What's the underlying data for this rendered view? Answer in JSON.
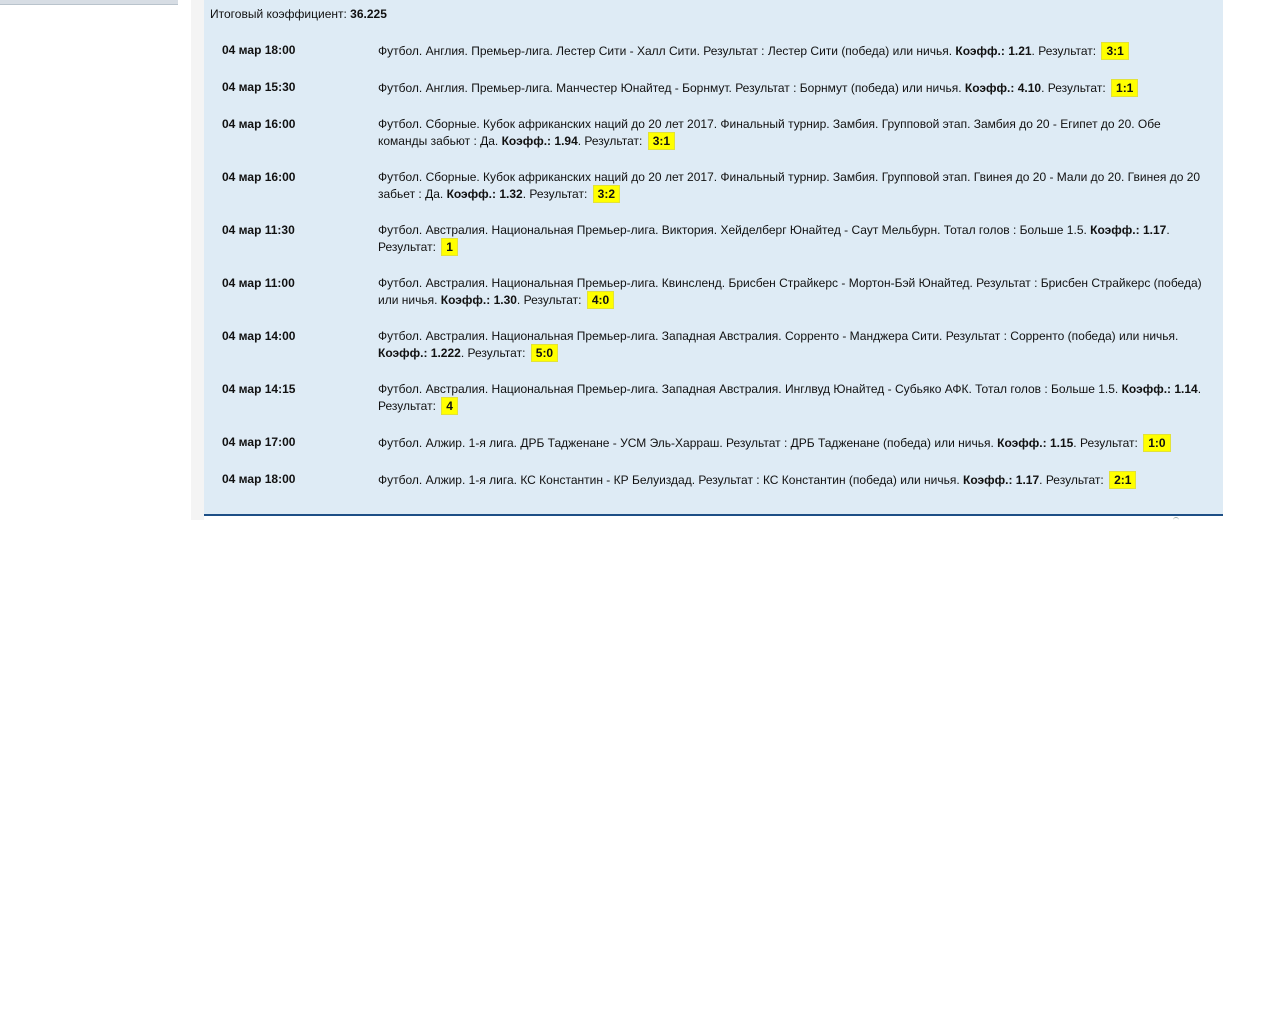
{
  "summary": {
    "total_label": "Итоговый коэффициент:",
    "total_value": "36.225"
  },
  "bets": [
    {
      "time": "04 мар 18:00",
      "text": "Футбол. Англия. Премьер-лига. Лестер Сити - Халл Сити. Результат : Лестер Сити (победа) или ничья.",
      "odds_label": "Коэфф.:",
      "odds": "1.21",
      "result_label": "Результат:",
      "result": "3:1"
    },
    {
      "time": "04 мар 15:30",
      "text": "Футбол. Англия. Премьер-лига. Манчестер Юнайтед - Борнмут. Результат : Борнмут (победа) или ничья.",
      "odds_label": "Коэфф.:",
      "odds": "4.10",
      "result_label": "Результат:",
      "result": "1:1"
    },
    {
      "time": "04 мар 16:00",
      "text": "Футбол. Сборные. Кубок африканских наций до 20 лет 2017. Финальный турнир. Замбия. Групповой этап. Замбия до 20 - Египет до 20. Обе команды забьют : Да.",
      "odds_label": "Коэфф.:",
      "odds": "1.94",
      "result_label": "Результат:",
      "result": "3:1"
    },
    {
      "time": "04 мар 16:00",
      "text": "Футбол. Сборные. Кубок африканских наций до 20 лет 2017. Финальный турнир. Замбия. Групповой этап. Гвинея до 20 - Мали до 20. Гвинея до 20 забьет : Да.",
      "odds_label": "Коэфф.:",
      "odds": "1.32",
      "result_label": "Результат:",
      "result": "3:2"
    },
    {
      "time": "04 мар 11:30",
      "text": "Футбол. Австралия. Национальная Премьер-лига. Виктория. Хейделберг Юнайтед - Саут Мельбурн. Тотал голов : Больше 1.5.",
      "odds_label": "Коэфф.:",
      "odds": "1.17",
      "result_label": "Результат:",
      "result": "1"
    },
    {
      "time": "04 мар 11:00",
      "text": "Футбол. Австралия. Национальная Премьер-лига. Квинсленд. Брисбен Страйкерс - Мортон-Бэй Юнайтед. Результат : Брисбен Страйкерс (победа) или ничья.",
      "odds_label": "Коэфф.:",
      "odds": "1.30",
      "result_label": "Результат:",
      "result": "4:0"
    },
    {
      "time": "04 мар 14:00",
      "text": "Футбол. Австралия. Национальная Премьер-лига. Западная Австралия. Сорренто - Манджера Сити. Результат : Сорренто (победа) или ничья.",
      "odds_label": "Коэфф.:",
      "odds": "1.222",
      "result_label": "Результат:",
      "result": "5:0"
    },
    {
      "time": "04 мар 14:15",
      "text": "Футбол. Австралия. Национальная Премьер-лига. Западная Австралия. Инглвуд Юнайтед - Субьяко АФК. Тотал голов : Больше 1.5.",
      "odds_label": "Коэфф.:",
      "odds": "1.14",
      "result_label": "Результат:",
      "result": "4"
    },
    {
      "time": "04 мар 17:00",
      "text": "Футбол. Алжир. 1-я лига. ДРБ Тадженане - УСМ Эль-Харраш. Результат : ДРБ Тадженане (победа) или ничья.",
      "odds_label": "Коэфф.:",
      "odds": "1.15",
      "result_label": "Результат:",
      "result": "1:0"
    },
    {
      "time": "04 мар 18:00",
      "text": "Футбол. Алжир. 1-я лига. КС Константин - КР Белуиздад. Результат : КС Константин (победа) или ничья.",
      "odds_label": "Коэфф.:",
      "odds": "1.17",
      "result_label": "Результат:",
      "result": "2:1"
    }
  ],
  "colors": {
    "panel_bg": "#deebf5",
    "panel_border": "#1d4f86",
    "result_highlight": "#ffff00"
  }
}
